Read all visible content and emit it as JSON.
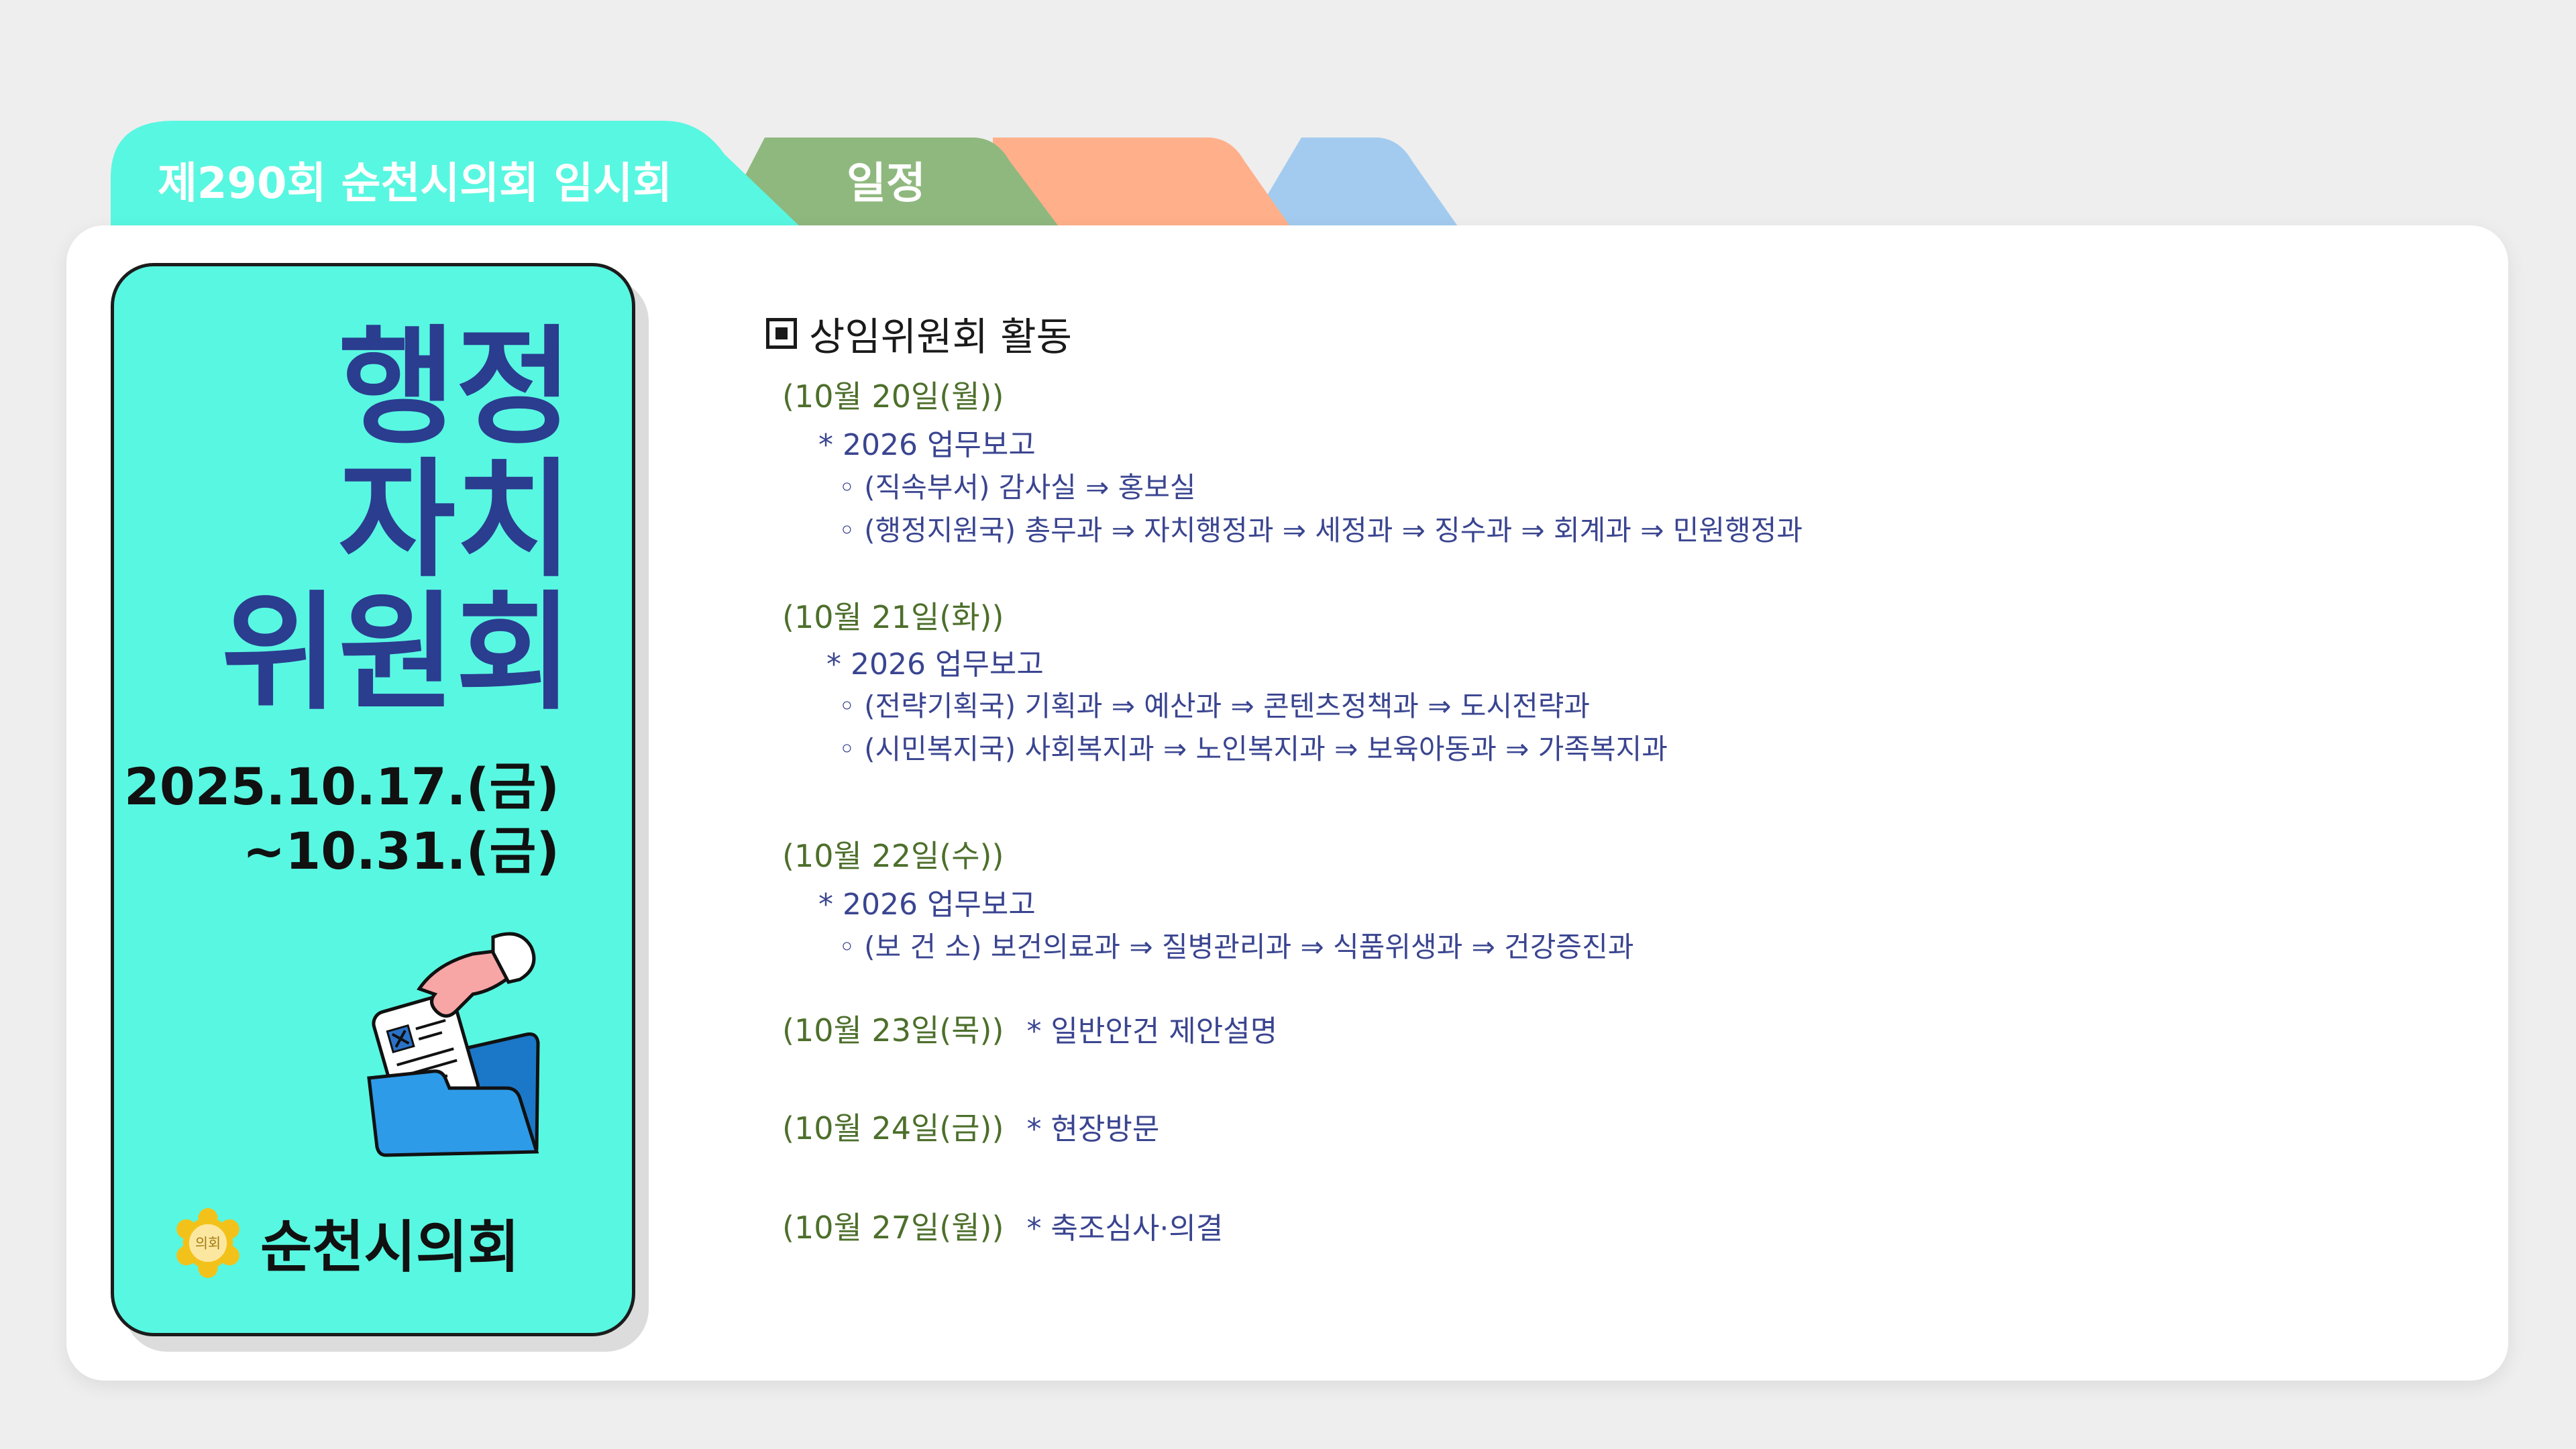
{
  "tabs": [
    {
      "label": "제290회 순천시의회 임시회",
      "color": "#58f7e1"
    },
    {
      "label": "일정",
      "color": "#8fb87e"
    },
    {
      "label": "",
      "color": "#ffb08a"
    },
    {
      "label": "",
      "color": "#a3cbef"
    }
  ],
  "sidebar": {
    "title_lines": [
      "행정",
      "자치",
      "위원회"
    ],
    "date_lines": [
      "2025.10.17.(금)",
      "~10.31.(금)"
    ],
    "logo_text": "순천시의회",
    "seal_text": "의회",
    "bg_color": "#58f7e1",
    "title_color": "#2a3d8f"
  },
  "schedule": {
    "heading": "상임위원회 활동",
    "entries": [
      {
        "date": "(10월  20일(월))",
        "note": "",
        "items": [
          "* 2026 업무보고"
        ],
        "subitems": [
          "◦ (직속부서) 감사실 ⇒ 홍보실",
          "◦ (행정지원국) 총무과 ⇒ 자치행정과 ⇒ 세정과 ⇒ 징수과 ⇒ 회계과 ⇒ 민원행정과"
        ]
      },
      {
        "date": "(10월 21일(화))",
        "note": "",
        "items": [
          "* 2026 업무보고"
        ],
        "subitems": [
          "◦ (전략기획국) 기획과 ⇒ 예산과 ⇒ 콘텐츠정책과 ⇒ 도시전략과",
          "◦ (시민복지국) 사회복지과 ⇒ 노인복지과 ⇒ 보육아동과 ⇒ 가족복지과"
        ]
      },
      {
        "date": "(10월  22일(수))",
        "note": "",
        "items": [
          "* 2026 업무보고"
        ],
        "subitems": [
          "◦ (보 건 소) 보건의료과 ⇒ 질병관리과 ⇒ 식품위생과 ⇒ 건강증진과"
        ]
      },
      {
        "date": "(10월 23일(목))",
        "note": "* 일반안건 제안설명",
        "items": [],
        "subitems": []
      },
      {
        "date": "(10월 24일(금))",
        "note": "* 현장방문",
        "items": [],
        "subitems": []
      },
      {
        "date": "(10월 27일(월))",
        "note": "* 축조심사·의결",
        "items": [],
        "subitems": []
      }
    ]
  },
  "icons": [
    "document-in-folder-icon",
    "council-seal-icon",
    "checkbox-square-icon"
  ]
}
